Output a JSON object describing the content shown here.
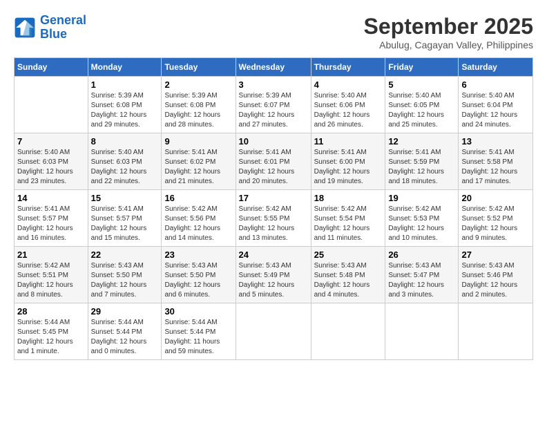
{
  "logo": {
    "line1": "General",
    "line2": "Blue"
  },
  "title": "September 2025",
  "location": "Abulug, Cagayan Valley, Philippines",
  "days_header": [
    "Sunday",
    "Monday",
    "Tuesday",
    "Wednesday",
    "Thursday",
    "Friday",
    "Saturday"
  ],
  "weeks": [
    [
      {
        "day": "",
        "info": ""
      },
      {
        "day": "1",
        "info": "Sunrise: 5:39 AM\nSunset: 6:08 PM\nDaylight: 12 hours\nand 29 minutes."
      },
      {
        "day": "2",
        "info": "Sunrise: 5:39 AM\nSunset: 6:08 PM\nDaylight: 12 hours\nand 28 minutes."
      },
      {
        "day": "3",
        "info": "Sunrise: 5:39 AM\nSunset: 6:07 PM\nDaylight: 12 hours\nand 27 minutes."
      },
      {
        "day": "4",
        "info": "Sunrise: 5:40 AM\nSunset: 6:06 PM\nDaylight: 12 hours\nand 26 minutes."
      },
      {
        "day": "5",
        "info": "Sunrise: 5:40 AM\nSunset: 6:05 PM\nDaylight: 12 hours\nand 25 minutes."
      },
      {
        "day": "6",
        "info": "Sunrise: 5:40 AM\nSunset: 6:04 PM\nDaylight: 12 hours\nand 24 minutes."
      }
    ],
    [
      {
        "day": "7",
        "info": "Sunrise: 5:40 AM\nSunset: 6:03 PM\nDaylight: 12 hours\nand 23 minutes."
      },
      {
        "day": "8",
        "info": "Sunrise: 5:40 AM\nSunset: 6:03 PM\nDaylight: 12 hours\nand 22 minutes."
      },
      {
        "day": "9",
        "info": "Sunrise: 5:41 AM\nSunset: 6:02 PM\nDaylight: 12 hours\nand 21 minutes."
      },
      {
        "day": "10",
        "info": "Sunrise: 5:41 AM\nSunset: 6:01 PM\nDaylight: 12 hours\nand 20 minutes."
      },
      {
        "day": "11",
        "info": "Sunrise: 5:41 AM\nSunset: 6:00 PM\nDaylight: 12 hours\nand 19 minutes."
      },
      {
        "day": "12",
        "info": "Sunrise: 5:41 AM\nSunset: 5:59 PM\nDaylight: 12 hours\nand 18 minutes."
      },
      {
        "day": "13",
        "info": "Sunrise: 5:41 AM\nSunset: 5:58 PM\nDaylight: 12 hours\nand 17 minutes."
      }
    ],
    [
      {
        "day": "14",
        "info": "Sunrise: 5:41 AM\nSunset: 5:57 PM\nDaylight: 12 hours\nand 16 minutes."
      },
      {
        "day": "15",
        "info": "Sunrise: 5:41 AM\nSunset: 5:57 PM\nDaylight: 12 hours\nand 15 minutes."
      },
      {
        "day": "16",
        "info": "Sunrise: 5:42 AM\nSunset: 5:56 PM\nDaylight: 12 hours\nand 14 minutes."
      },
      {
        "day": "17",
        "info": "Sunrise: 5:42 AM\nSunset: 5:55 PM\nDaylight: 12 hours\nand 13 minutes."
      },
      {
        "day": "18",
        "info": "Sunrise: 5:42 AM\nSunset: 5:54 PM\nDaylight: 12 hours\nand 11 minutes."
      },
      {
        "day": "19",
        "info": "Sunrise: 5:42 AM\nSunset: 5:53 PM\nDaylight: 12 hours\nand 10 minutes."
      },
      {
        "day": "20",
        "info": "Sunrise: 5:42 AM\nSunset: 5:52 PM\nDaylight: 12 hours\nand 9 minutes."
      }
    ],
    [
      {
        "day": "21",
        "info": "Sunrise: 5:42 AM\nSunset: 5:51 PM\nDaylight: 12 hours\nand 8 minutes."
      },
      {
        "day": "22",
        "info": "Sunrise: 5:43 AM\nSunset: 5:50 PM\nDaylight: 12 hours\nand 7 minutes."
      },
      {
        "day": "23",
        "info": "Sunrise: 5:43 AM\nSunset: 5:50 PM\nDaylight: 12 hours\nand 6 minutes."
      },
      {
        "day": "24",
        "info": "Sunrise: 5:43 AM\nSunset: 5:49 PM\nDaylight: 12 hours\nand 5 minutes."
      },
      {
        "day": "25",
        "info": "Sunrise: 5:43 AM\nSunset: 5:48 PM\nDaylight: 12 hours\nand 4 minutes."
      },
      {
        "day": "26",
        "info": "Sunrise: 5:43 AM\nSunset: 5:47 PM\nDaylight: 12 hours\nand 3 minutes."
      },
      {
        "day": "27",
        "info": "Sunrise: 5:43 AM\nSunset: 5:46 PM\nDaylight: 12 hours\nand 2 minutes."
      }
    ],
    [
      {
        "day": "28",
        "info": "Sunrise: 5:44 AM\nSunset: 5:45 PM\nDaylight: 12 hours\nand 1 minute."
      },
      {
        "day": "29",
        "info": "Sunrise: 5:44 AM\nSunset: 5:44 PM\nDaylight: 12 hours\nand 0 minutes."
      },
      {
        "day": "30",
        "info": "Sunrise: 5:44 AM\nSunset: 5:44 PM\nDaylight: 11 hours\nand 59 minutes."
      },
      {
        "day": "",
        "info": ""
      },
      {
        "day": "",
        "info": ""
      },
      {
        "day": "",
        "info": ""
      },
      {
        "day": "",
        "info": ""
      }
    ]
  ]
}
